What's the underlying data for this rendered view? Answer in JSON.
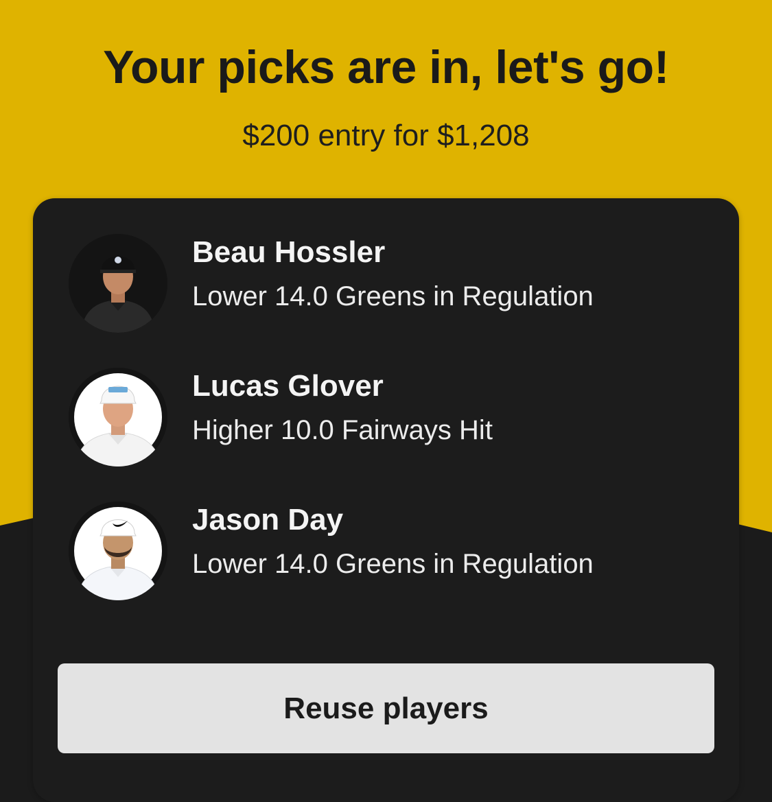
{
  "header": {
    "title": "Your picks are in, let's go!",
    "subtitle": "$200 entry for $1,208"
  },
  "colors": {
    "accent_yellow": "#dfb300",
    "card_background": "#1c1c1c",
    "button_background": "#e3e3e3"
  },
  "picks": [
    {
      "name": "Beau Hossler",
      "line": "Lower 14.0 Greens in Regulation",
      "avatar_icon": "player-headshot-dark-shirt"
    },
    {
      "name": "Lucas Glover",
      "line": "Higher 10.0 Fairways Hit",
      "avatar_icon": "player-headshot-white-shirt"
    },
    {
      "name": "Jason Day",
      "line": "Lower 14.0 Greens in Regulation",
      "avatar_icon": "player-headshot-white-shirt"
    }
  ],
  "actions": {
    "reuse_label": "Reuse players"
  }
}
